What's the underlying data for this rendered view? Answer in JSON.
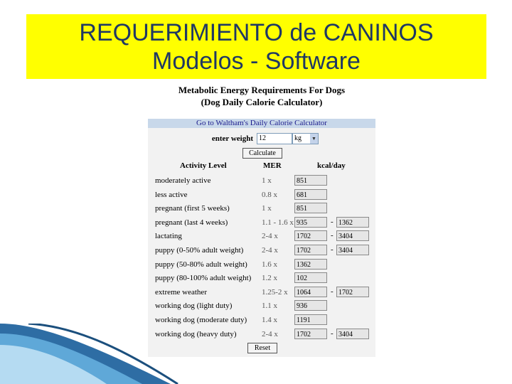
{
  "slide": {
    "title_line1": "REQUERIMIENTO de CANINOS",
    "title_line2": "Modelos - Software"
  },
  "calculator": {
    "heading_line1": "Metabolic Energy Requirements For Dogs",
    "heading_line2": "(Dog Daily Calorie Calculator)",
    "link_text": "Go to Waltham's Daily Calorie Calculator",
    "weight_label": "enter weight",
    "weight_value": "12",
    "unit_value": "kg",
    "calculate_label": "Calculate",
    "reset_label": "Reset",
    "columns": {
      "activity": "Activity Level",
      "mer": "MER",
      "kcal": "kcal/day"
    },
    "rows": [
      {
        "activity": "moderately active",
        "mer": "1 x",
        "low": "851",
        "high": ""
      },
      {
        "activity": "less active",
        "mer": "0.8 x",
        "low": "681",
        "high": ""
      },
      {
        "activity": "pregnant (first 5 weeks)",
        "mer": "1 x",
        "low": "851",
        "high": ""
      },
      {
        "activity": "pregnant (last 4 weeks)",
        "mer": "1.1 - 1.6 x",
        "low": "935",
        "high": "1362"
      },
      {
        "activity": "lactating",
        "mer": "2-4 x",
        "low": "1702",
        "high": "3404"
      },
      {
        "activity": "puppy (0-50% adult weight)",
        "mer": "2-4 x",
        "low": "1702",
        "high": "3404"
      },
      {
        "activity": "puppy (50-80% adult weight)",
        "mer": "1.6 x",
        "low": "1362",
        "high": ""
      },
      {
        "activity": "puppy (80-100% adult weight)",
        "mer": "1.2 x",
        "low": "102",
        "high": ""
      },
      {
        "activity": "extreme weather",
        "mer": "1.25-2 x",
        "low": "1064",
        "high": "1702"
      },
      {
        "activity": "working dog (light duty)",
        "mer": "1.1 x",
        "low": "936",
        "high": ""
      },
      {
        "activity": "working dog (moderate duty)",
        "mer": "1.4 x",
        "low": "1191",
        "high": ""
      },
      {
        "activity": "working dog (heavy duty)",
        "mer": "2-4 x",
        "low": "1702",
        "high": "3404"
      }
    ]
  },
  "colors": {
    "title_bg": "#ffff00",
    "title_text": "#1f3864",
    "panel_bg": "#f2f2f2",
    "link_bar_bg": "#c8d8ea",
    "decoration_blue": "#2e6da4"
  }
}
